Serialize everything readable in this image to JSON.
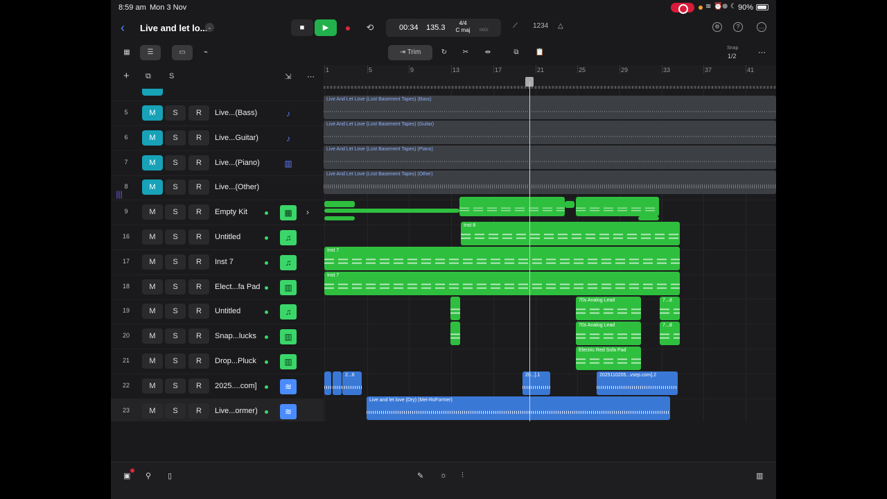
{
  "status": {
    "time": "8:59 am",
    "date": "Mon 3 Nov",
    "battery": "90%"
  },
  "project": {
    "title": "Live and let lo..."
  },
  "transport": {
    "position": "00:34",
    "tempo": "135.3",
    "time_sig": "4/4",
    "key": "C maj",
    "midi": "MIDI",
    "count_in": "1234"
  },
  "toolbar": {
    "trim_label": "Trim",
    "snap_label": "Snap",
    "snap_value": "1/2"
  },
  "header": {
    "add": "+",
    "solo_label": "S"
  },
  "ruler": {
    "bars": [
      "1",
      "5",
      "9",
      "13",
      "17",
      "21",
      "25",
      "29",
      "33",
      "37",
      "41"
    ]
  },
  "tracks": [
    {
      "num": "5",
      "name": "Live...(Bass)",
      "mute_on": true,
      "icon": "guitar-icon"
    },
    {
      "num": "6",
      "name": "Live...Guitar)",
      "mute_on": true,
      "icon": "guitar-icon"
    },
    {
      "num": "7",
      "name": "Live...(Piano)",
      "mute_on": true,
      "icon": "piano-icon"
    },
    {
      "num": "8",
      "name": "Live...(Other)",
      "mute_on": true,
      "icon": "waveform-icon"
    },
    {
      "num": "9",
      "name": "Empty Kit",
      "mute_on": false,
      "icon": "drum-kit-icon"
    },
    {
      "num": "16",
      "name": "Untitled",
      "mute_on": false,
      "icon": "music-note-icon"
    },
    {
      "num": "17",
      "name": "Inst 7",
      "mute_on": false,
      "icon": "music-note-icon"
    },
    {
      "num": "18",
      "name": "Elect...fa Pad",
      "mute_on": false,
      "icon": "keyboard-icon"
    },
    {
      "num": "19",
      "name": "Untitled",
      "mute_on": false,
      "icon": "music-note-icon"
    },
    {
      "num": "20",
      "name": "Snap...lucks",
      "mute_on": false,
      "icon": "keyboard-icon"
    },
    {
      "num": "21",
      "name": "Drop...Pluck",
      "mute_on": false,
      "icon": "keyboard-icon"
    },
    {
      "num": "22",
      "name": "2025....com]",
      "mute_on": false,
      "icon": "audio-icon"
    },
    {
      "num": "23",
      "name": "Live...ormer)",
      "mute_on": false,
      "icon": "audio-icon"
    }
  ],
  "buttons": {
    "m": "M",
    "s": "S",
    "r": "R"
  },
  "regions": {
    "bass": "Live And Let Love (Lost Basement Tapes) (Bass)",
    "guitar": "Live And Let Love (Lost Basement Tapes) (Guitar)",
    "piano": "Live And Let Love (Lost Basement Tapes) (Piano)",
    "other": "Live And Let Love (Lost Basement Tapes) (Other)",
    "inst8": "Inst 8",
    "inst7a": "Inst 7",
    "inst7b": "Inst 7",
    "lead1": "70s Analog Lead",
    "lead1b": "7...d",
    "lead2": "70s Analog Lead",
    "lead2b": "7...d",
    "pad": "Electric Red Sofa Pad",
    "audio1": "2...6",
    "audio2": "20...].1",
    "audio3": "2025110205...vsep.com].2",
    "dry": "Live and let love (Dry) (Mel-RoFormer)"
  }
}
